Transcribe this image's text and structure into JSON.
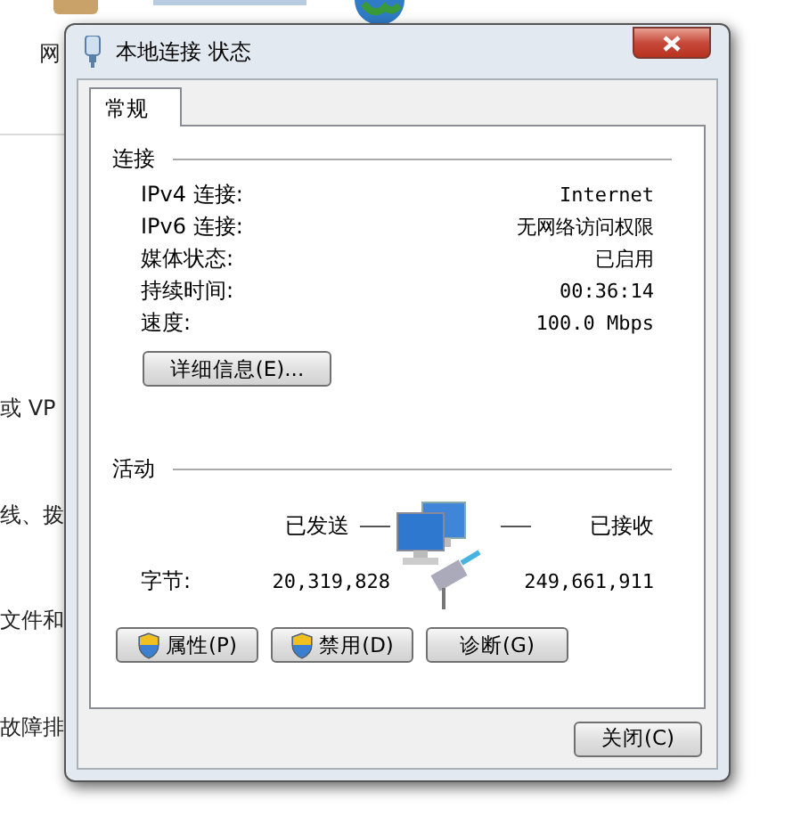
{
  "background": {
    "fragments": [
      "网",
      "或 VP",
      "线、拨",
      "文件和",
      "故障排"
    ]
  },
  "window": {
    "title": "本地连接 状态"
  },
  "tabs": [
    {
      "label": "常规",
      "selected": true
    }
  ],
  "connection": {
    "title": "连接",
    "rows": [
      {
        "label": "IPv4 连接:",
        "value": "Internet"
      },
      {
        "label": "IPv6 连接:",
        "value": "无网络访问权限"
      },
      {
        "label": "媒体状态:",
        "value": "已启用"
      },
      {
        "label": "持续时间:",
        "value": "00:36:14"
      },
      {
        "label": "速度:",
        "value": "100.0 Mbps"
      }
    ],
    "details_button": "详细信息(E)..."
  },
  "activity": {
    "title": "活动",
    "sent_label": "已发送",
    "received_label": "已接收",
    "bytes_label": "字节:",
    "bytes_sent": "20,319,828",
    "bytes_received": "249,661,911"
  },
  "buttons": [
    {
      "label": "属性(P)",
      "shield": true
    },
    {
      "label": "禁用(D)",
      "shield": true
    },
    {
      "label": "诊断(G)",
      "shield": false
    }
  ],
  "close_button": "关闭(C)"
}
